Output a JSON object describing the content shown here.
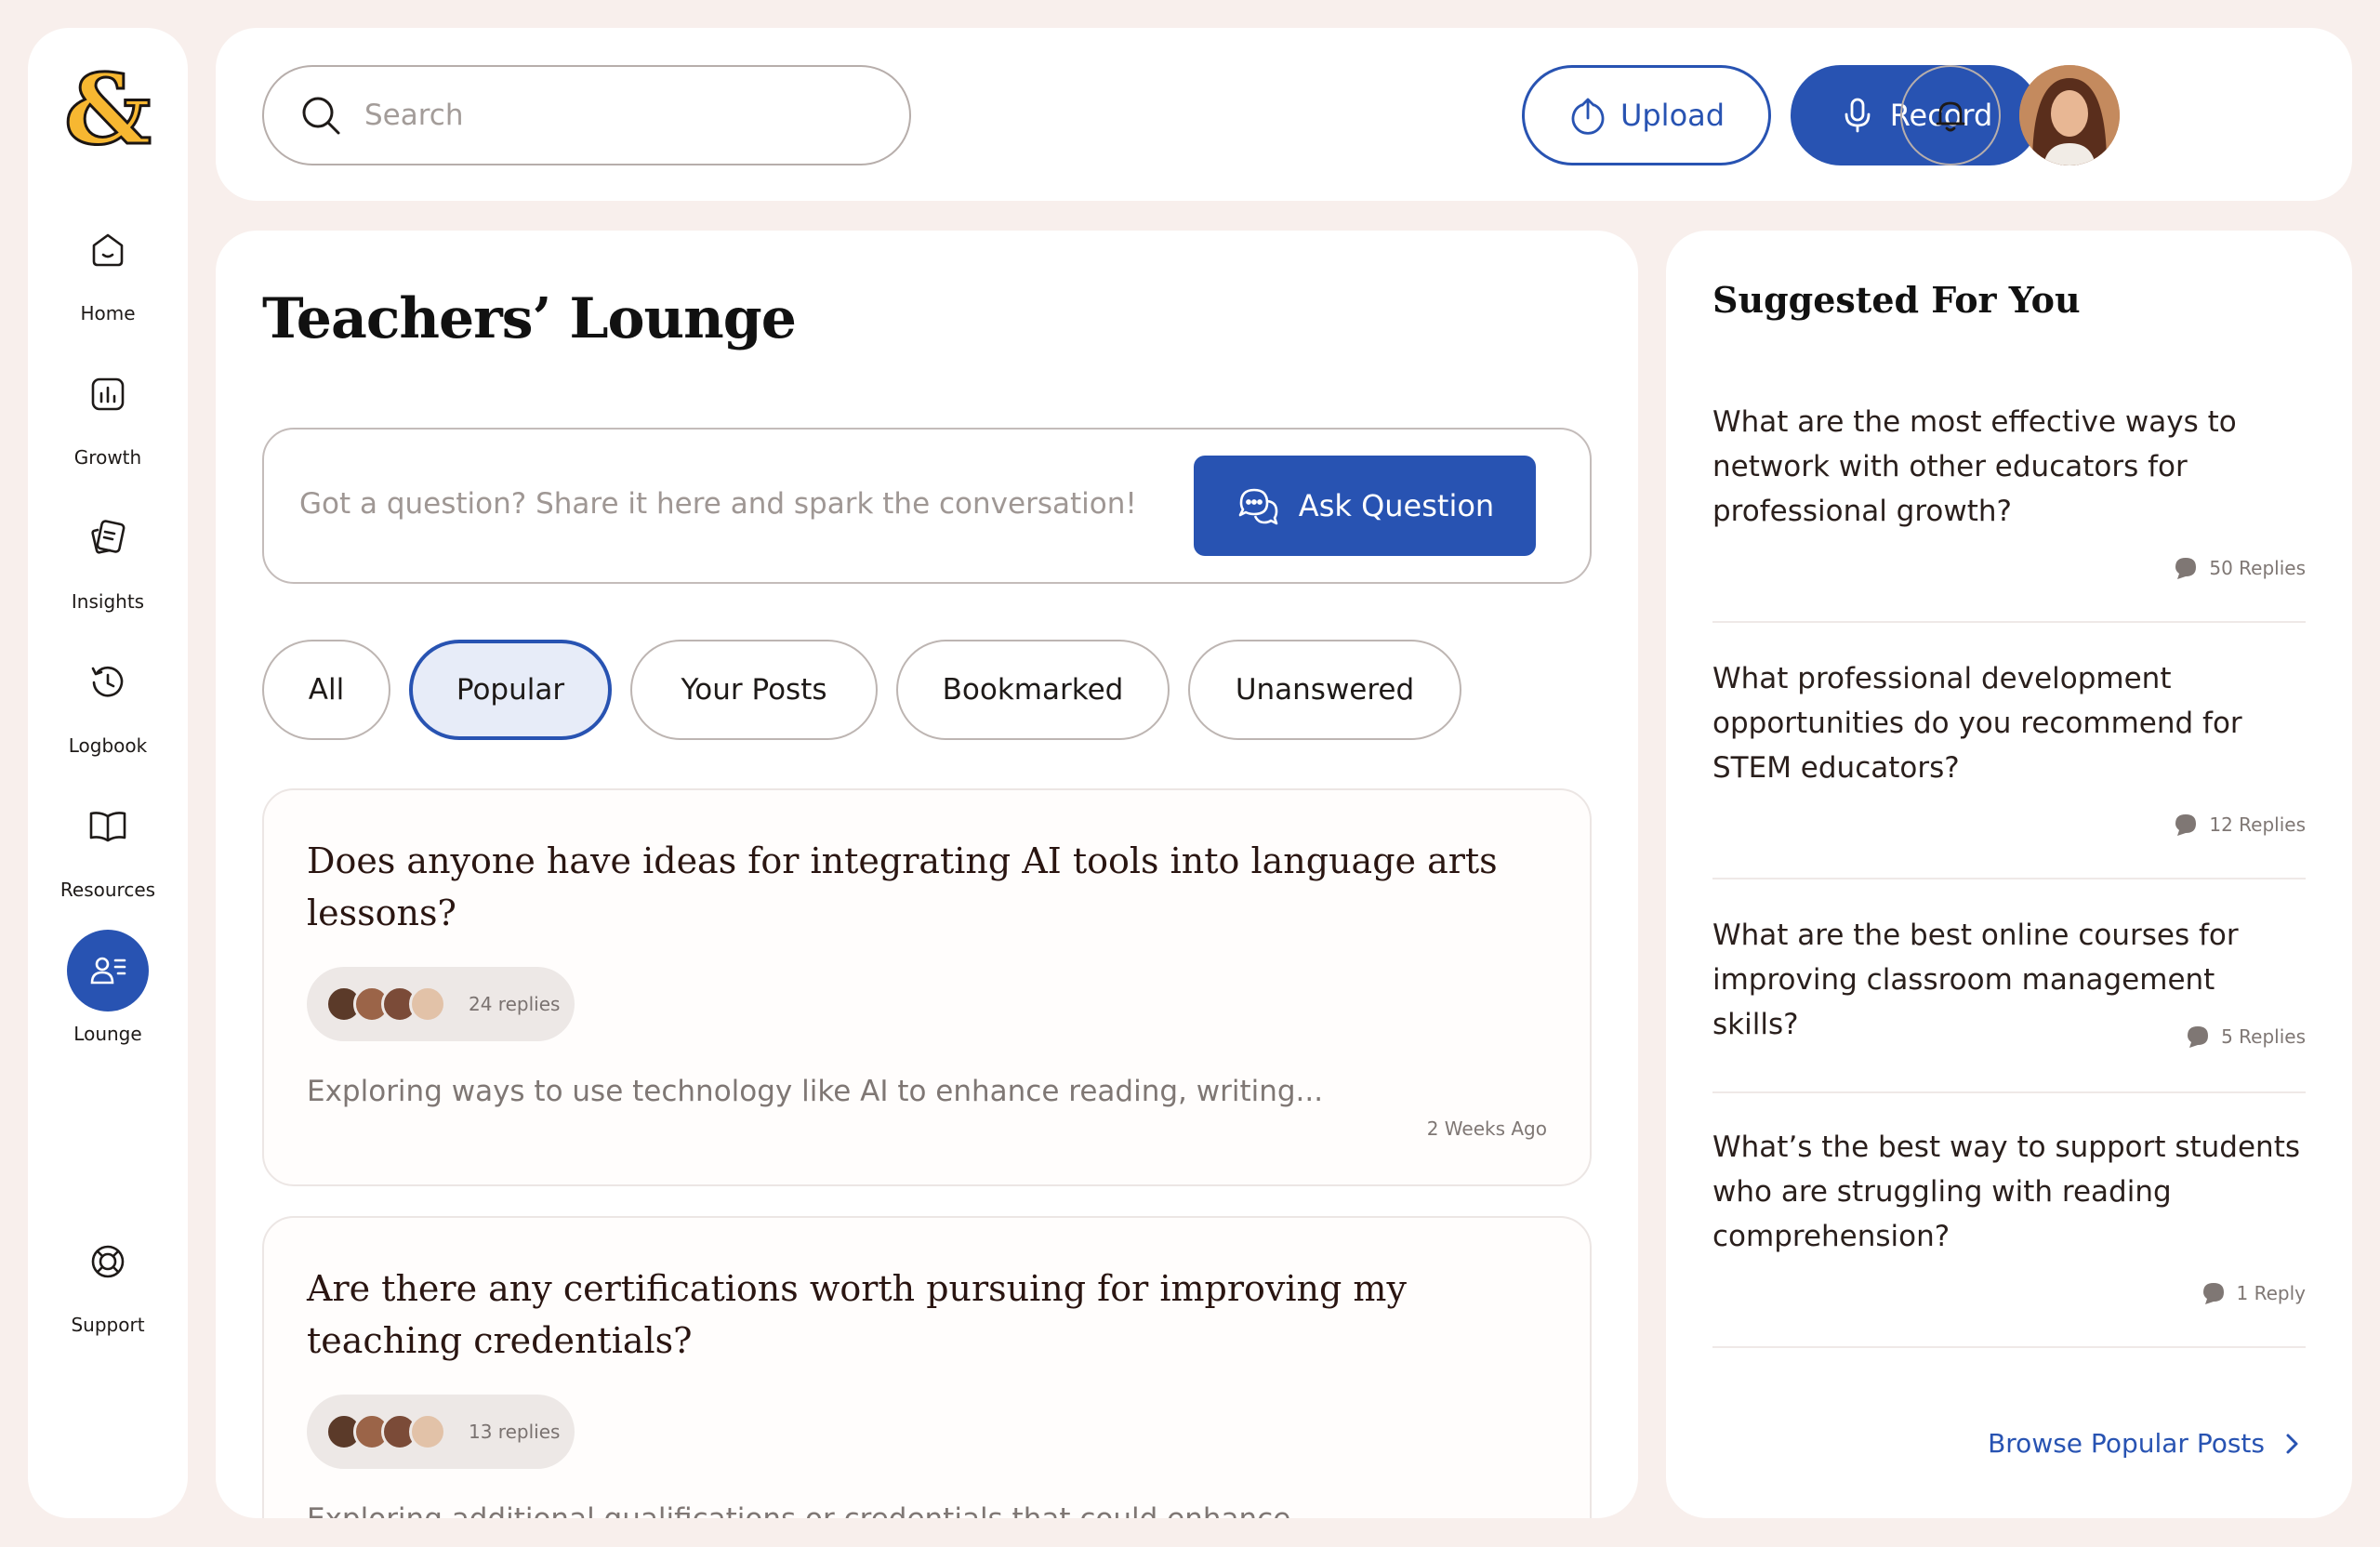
{
  "brand": {
    "logo_glyph": "&",
    "logo_color": "#f7b731"
  },
  "colors": {
    "accent": "#2853b2",
    "background": "#f8efec"
  },
  "sidebar": {
    "items": [
      {
        "label": "Home",
        "icon": "home-icon",
        "active": false
      },
      {
        "label": "Growth",
        "icon": "chart-icon",
        "active": false
      },
      {
        "label": "Insights",
        "icon": "cards-icon",
        "active": false
      },
      {
        "label": "Logbook",
        "icon": "clock-icon",
        "active": false
      },
      {
        "label": "Resources",
        "icon": "book-icon",
        "active": false
      },
      {
        "label": "Lounge",
        "icon": "people-icon",
        "active": true
      }
    ],
    "support": {
      "label": "Support",
      "icon": "lifebuoy-icon"
    }
  },
  "header": {
    "search_placeholder": "Search",
    "upload_label": "Upload",
    "record_label": "Record"
  },
  "main": {
    "title": "Teachers’ Lounge",
    "ask_placeholder": "Got a question? Share it here and spark the conversation!",
    "ask_button": "Ask Question",
    "filters": [
      {
        "label": "All",
        "active": false
      },
      {
        "label": "Popular",
        "active": true
      },
      {
        "label": "Your Posts",
        "active": false
      },
      {
        "label": "Bookmarked",
        "active": false
      },
      {
        "label": "Unanswered",
        "active": false
      }
    ],
    "posts": [
      {
        "title": "Does anyone have ideas for integrating AI tools into language arts lessons?",
        "replies": "24 replies",
        "excerpt": "Exploring ways to use technology like AI to enhance reading, writing...",
        "time": "2 Weeks Ago"
      },
      {
        "title": "Are there any certifications worth pursuing for improving my teaching credentials?",
        "replies": "13 replies",
        "excerpt": "Exploring additional qualifications or credentials that could enhance...",
        "time": ""
      }
    ]
  },
  "suggested": {
    "title": "Suggested For You",
    "items": [
      {
        "question": "What are the most effective ways to network with other educators for professional growth?",
        "replies": "50 Replies"
      },
      {
        "question": "What professional development opportunities do you recommend for STEM educators?",
        "replies": "12 Replies"
      },
      {
        "question": "What are the best online courses for improving classroom management skills?",
        "replies": "5 Replies"
      },
      {
        "question": "What’s the best way to support students who are struggling with reading comprehension?",
        "replies": "1 Reply"
      }
    ],
    "browse_label": "Browse Popular Posts"
  }
}
